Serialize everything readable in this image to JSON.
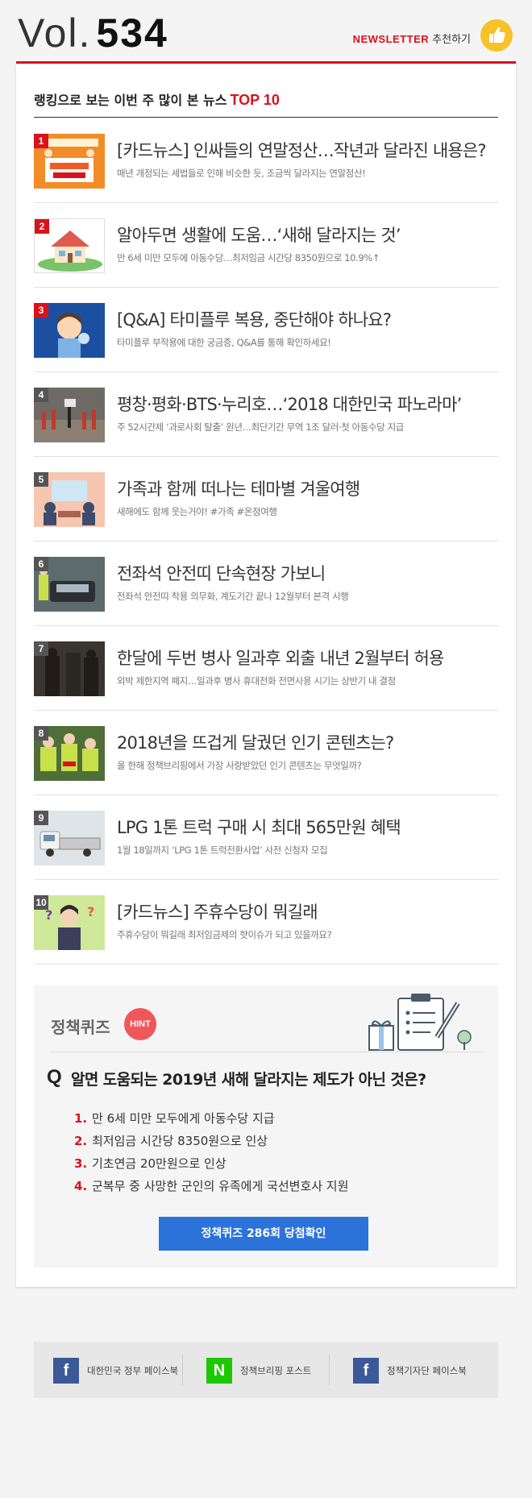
{
  "header": {
    "vol_label": "Vol.",
    "vol_number": "534",
    "newsletter_label": "NEWSLETTER",
    "recommend_label": "추천하기"
  },
  "section": {
    "title": "랭킹으로 보는 이번 주 많이 본 뉴스",
    "title_accent": "TOP 10"
  },
  "items": [
    {
      "rank": "1",
      "title": "[카드뉴스] 인싸들의 연말정산…작년과 달라진 내용은?",
      "sub": "매년 개정되는 세법들로 인해 비슷한 듯, 조금씩 달라지는 연말정산!"
    },
    {
      "rank": "2",
      "title": "알아두면 생활에 도움…‘새해 달라지는 것’",
      "sub": "만 6세 미만 모두에 아동수당…최저임금 시간당 8350원으로 10.9%↑"
    },
    {
      "rank": "3",
      "title": "[Q&A] 타미플루 복용, 중단해야 하나요?",
      "sub": "타미플루 부작용에 대한 궁금증, Q&A를 통해 확인하세요!"
    },
    {
      "rank": "4",
      "title": "평창·평화·BTS·누리호…‘2018 대한민국 파노라마’",
      "sub": "주 52시간제 ‘과로사회 탈출’ 원년…최단기간 무역 1조 달러·첫 아동수당 지급"
    },
    {
      "rank": "5",
      "title": "가족과 함께 떠나는 테마별 겨울여행",
      "sub": "새해에도 함께 웃는거야! #가족 #온정여행"
    },
    {
      "rank": "6",
      "title": "전좌석 안전띠 단속현장 가보니",
      "sub": "전좌석 안전띠 착용 의무화, 계도기간 끝나 12월부터 본격 시행"
    },
    {
      "rank": "7",
      "title": "한달에 두번 병사 일과후 외출 내년 2월부터 허용",
      "sub": "외박 제한지역 폐지…일과후 병사 휴대전화 전면사용 시기는 상반기 내 결정"
    },
    {
      "rank": "8",
      "title": "2018년을 뜨겁게 달궜던 인기 콘텐츠는?",
      "sub": "올 한해 정책브리핑에서 가장 사랑받았던 인기 콘텐츠는 무엇일까?"
    },
    {
      "rank": "9",
      "title": "LPG 1톤 트럭 구매 시 최대 565만원 혜택",
      "sub": "1월 18일까지 ‘LPG 1톤 트럭전환사업’ 사전 신청자 모집"
    },
    {
      "rank": "10",
      "title": "[카드뉴스] 주휴수당이 뭐길래",
      "sub": "주휴수당이 뭐길래 최저임금제의 핫이슈가 되고 있을까요?"
    }
  ],
  "quiz": {
    "title": "정책퀴즈",
    "hint": "HINT",
    "q_mark": "Q",
    "question": "알면 도움되는 2019년 새해 달라지는 제도가 아닌 것은?",
    "options": [
      {
        "num": "1.",
        "text": "만 6세 미만 모두에게 아동수당 지급"
      },
      {
        "num": "2.",
        "text": "최저임금 시간당 8350원으로 인상"
      },
      {
        "num": "3.",
        "text": "기초연금 20만원으로 인상"
      },
      {
        "num": "4.",
        "text": "군복무 중 사망한 군인의 유족에게 국선변호사 지원"
      }
    ],
    "button": "정책퀴즈 286회 당첨확인"
  },
  "footer": {
    "links": [
      {
        "icon": "f",
        "label": "대한민국 정부 페이스북"
      },
      {
        "icon": "N",
        "label": "정책브리핑 포스트"
      },
      {
        "icon": "f",
        "label": "정책기자단 페이스북"
      }
    ]
  },
  "colors": {
    "accent": "#d9121c",
    "button": "#2b73d9",
    "hint": "#f0575a",
    "facebook": "#3b5998",
    "naver": "#1ec800"
  }
}
